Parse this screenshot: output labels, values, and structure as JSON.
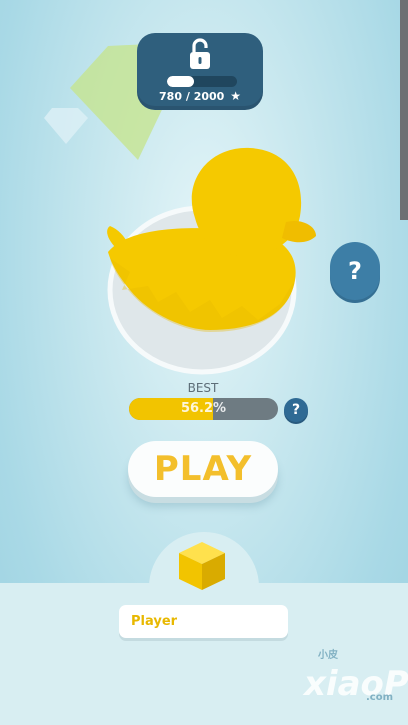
{
  "unlock": {
    "current": "780",
    "separator": "/",
    "total": "2000",
    "progress": 0.39,
    "icon": "unlocked-padlock-icon",
    "star_icon": "star-icon"
  },
  "best": {
    "label": "BEST",
    "percent_text": "56.2%",
    "percent": 56.2,
    "help_icon": "question-mark-icon"
  },
  "help_bubble": {
    "label": "?"
  },
  "play": {
    "label": "PLAY"
  },
  "player": {
    "name": "Player"
  },
  "skin": {
    "icon": "yellow-cube-icon",
    "color": "#f2c400"
  },
  "watermark": {
    "text": "xiaoPi",
    "small": "小皮",
    "domain": ".com"
  },
  "colors": {
    "accent": "#f2c400",
    "badge": "#2f5f7d",
    "background": "#c9e8ef"
  }
}
